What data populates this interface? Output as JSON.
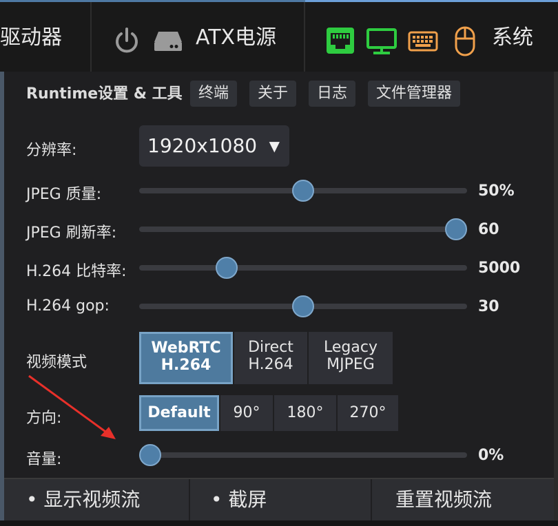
{
  "topbar": {
    "drives_label": "驱动器",
    "atx_label": "ATX电源",
    "system_label": "系统"
  },
  "icons": {
    "power": "power-icon",
    "drive": "drive-icon",
    "network": "network-icon",
    "monitor": "monitor-icon",
    "keyboard": "keyboard-icon",
    "mouse": "mouse-icon"
  },
  "colors": {
    "accent": "#4e7a9e",
    "network_icon": "#2ecc40",
    "monitor_icon": "#2ecc40",
    "keyboard_icon": "#f0a04b",
    "mouse_icon": "#f0a04b"
  },
  "panel": {
    "title": "Runtime设置 & 工具",
    "tabs": [
      "终端",
      "关于",
      "日志",
      "文件管理器"
    ]
  },
  "settings": {
    "resolution": {
      "label": "分辨率:",
      "value": "1920x1080",
      "caret": "▼"
    },
    "jpeg_quality": {
      "label": "JPEG 质量:",
      "value": "50%",
      "fraction": 0.5
    },
    "jpeg_fps": {
      "label": "JPEG 刷新率:",
      "value": "60",
      "fraction": 1.0
    },
    "h264_bitrate": {
      "label": "H.264 比特率:",
      "value": "5000",
      "fraction": 0.25
    },
    "h264_gop": {
      "label": "H.264 gop:",
      "value": "30",
      "fraction": 0.5
    },
    "video_mode": {
      "label": "视频模式",
      "options": [
        {
          "line1": "WebRTC",
          "line2": "H.264",
          "selected": true
        },
        {
          "line1": "Direct",
          "line2": "H.264",
          "selected": false
        },
        {
          "line1": "Legacy",
          "line2": "MJPEG",
          "selected": false
        }
      ]
    },
    "orientation": {
      "label": "方向:",
      "options": [
        "Default",
        "90°",
        "180°",
        "270°"
      ],
      "selected": "Default"
    },
    "volume": {
      "label": "音量:",
      "value": "0%",
      "fraction": 0.0
    }
  },
  "bottom": {
    "show_stream": "• 显示视频流",
    "screenshot": "• 截屏",
    "reset_stream": "重置视频流"
  }
}
